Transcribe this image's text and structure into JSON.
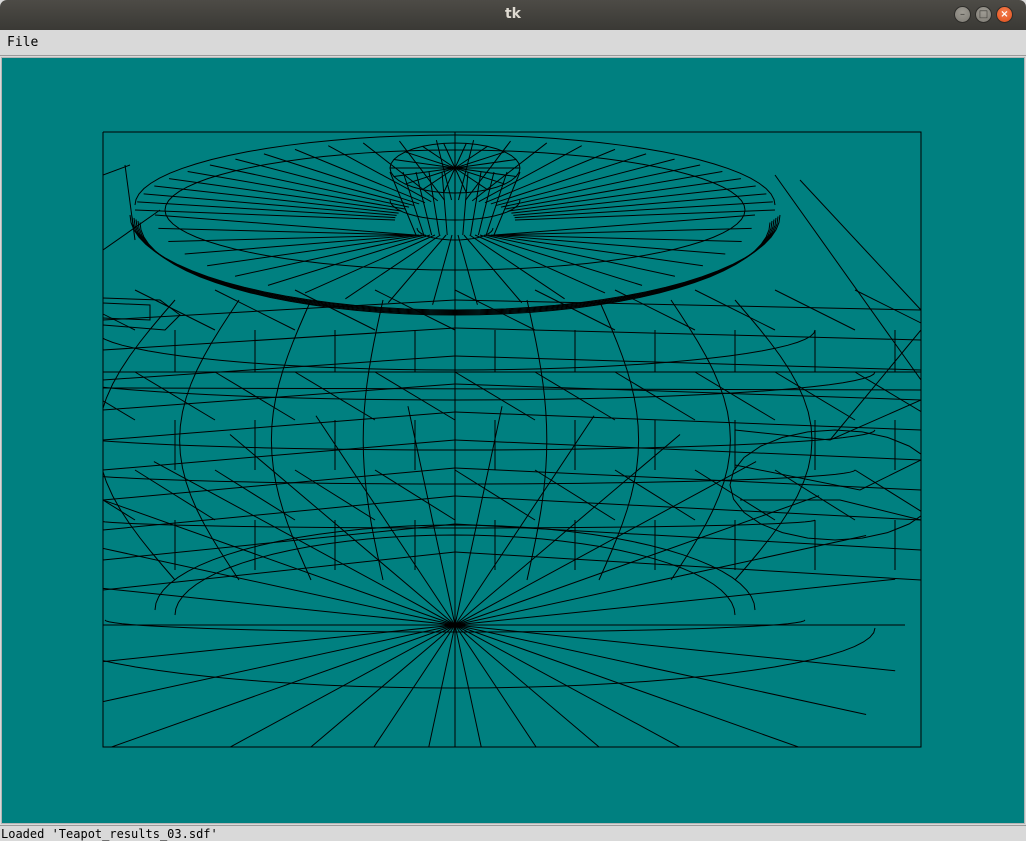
{
  "window": {
    "title": "tk",
    "controls": {
      "minimize_icon": "minimize-icon",
      "maximize_icon": "maximize-icon",
      "close_icon": "close-icon"
    }
  },
  "menubar": {
    "items": [
      {
        "label": "File"
      }
    ]
  },
  "canvas": {
    "background_color": "#008080",
    "line_color": "#000000",
    "content": "teapot wireframe mesh"
  },
  "status": {
    "text": "Loaded 'Teapot_results_03.sdf'"
  }
}
